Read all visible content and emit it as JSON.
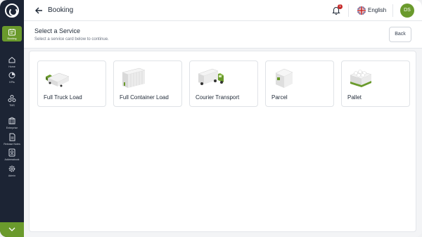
{
  "header": {
    "title": "Booking",
    "notification_count": "1",
    "language": "English",
    "user_initials": "DS"
  },
  "sidebar": {
    "items": [
      {
        "label": "Booking",
        "icon": "booking-icon",
        "active": true
      },
      {
        "label": "Home",
        "icon": "home-icon"
      },
      {
        "label": "KPIs",
        "icon": "kpi-icon"
      },
      {
        "label": "TMS",
        "icon": "tms-icon"
      },
      {
        "label": "Enterprise",
        "icon": "enterprise-icon"
      },
      {
        "label": "Release Notes",
        "icon": "release-notes-icon"
      },
      {
        "label": "Addressbook",
        "icon": "addressbook-icon"
      },
      {
        "label": "Admin",
        "icon": "gear-icon"
      }
    ]
  },
  "subheader": {
    "title": "Select a Service",
    "description": "Select a service card below to continue.",
    "back_label": "Back"
  },
  "services": [
    {
      "name": "Full Truck Load",
      "icon": "truck-icon"
    },
    {
      "name": "Full Container Load",
      "icon": "container-icon"
    },
    {
      "name": "Courier Transport",
      "icon": "courier-van-icon"
    },
    {
      "name": "Parcel",
      "icon": "parcel-icon"
    },
    {
      "name": "Pallet",
      "icon": "pallet-icon"
    }
  ],
  "colors": {
    "sidebar_bg": "#1c2434",
    "accent": "#6a9a2c",
    "badge": "#c62828"
  }
}
